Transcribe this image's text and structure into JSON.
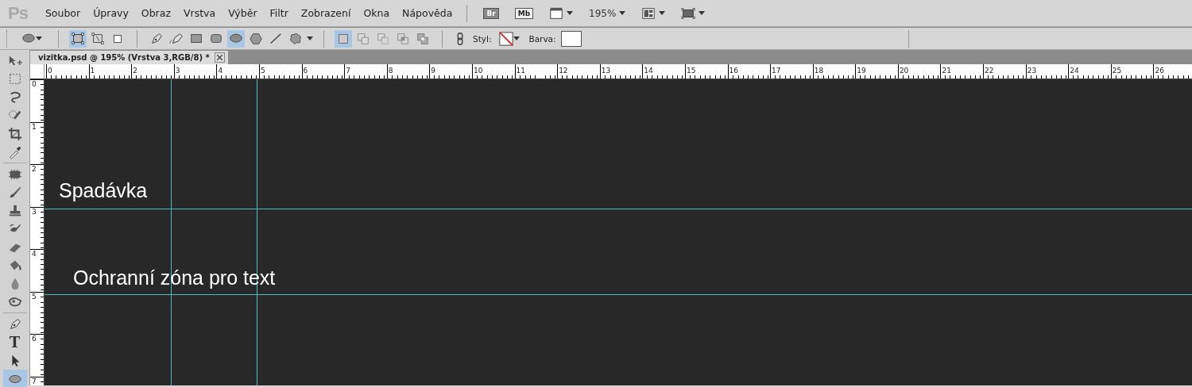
{
  "app_bar": {
    "logo": "Ps",
    "menu": [
      "Soubor",
      "Úpravy",
      "Obraz",
      "Vrstva",
      "Výběr",
      "Filtr",
      "Zobrazení",
      "Okna",
      "Nápověda"
    ],
    "buttons": [
      {
        "kind": "badge",
        "label": "Br"
      },
      {
        "kind": "badge",
        "label": "Mb"
      },
      {
        "kind": "frames"
      },
      {
        "kind": "zoom",
        "label": "195%"
      },
      {
        "kind": "arrange"
      },
      {
        "kind": "screen"
      }
    ]
  },
  "options_bar": {
    "preset": {
      "kind": "ellipse"
    },
    "modes": [
      {
        "kind": "shape-layer",
        "selected": true
      },
      {
        "kind": "paths",
        "selected": false
      },
      {
        "kind": "fill-pixels",
        "selected": false
      }
    ],
    "shapes": [
      {
        "kind": "pen",
        "selected": false
      },
      {
        "kind": "freeform-pen",
        "selected": false
      },
      {
        "kind": "rect",
        "selected": false
      },
      {
        "kind": "rounded-rect",
        "selected": false
      },
      {
        "kind": "ellipse",
        "selected": true
      },
      {
        "kind": "polygon",
        "selected": false
      },
      {
        "kind": "line",
        "selected": false
      },
      {
        "kind": "custom-shape",
        "selected": false
      }
    ],
    "combine": [
      {
        "kind": "new",
        "selected": true
      },
      {
        "kind": "add",
        "selected": false
      },
      {
        "kind": "subtract",
        "selected": false
      },
      {
        "kind": "intersect",
        "selected": false
      },
      {
        "kind": "exclude",
        "selected": false
      }
    ],
    "style_label": "Styl:",
    "color_label": "Barva:"
  },
  "toolbox": [
    [
      {
        "kind": "move",
        "selected": false
      },
      {
        "kind": "marquee",
        "selected": false
      },
      {
        "kind": "lasso",
        "selected": false
      },
      {
        "kind": "quick-select",
        "selected": false
      },
      {
        "kind": "crop",
        "selected": false
      },
      {
        "kind": "eyedropper",
        "selected": false
      }
    ],
    [
      {
        "kind": "healing",
        "selected": false
      },
      {
        "kind": "brush",
        "selected": false
      },
      {
        "kind": "stamp",
        "selected": false
      },
      {
        "kind": "history-brush",
        "selected": false
      },
      {
        "kind": "eraser",
        "selected": false
      },
      {
        "kind": "bucket",
        "selected": false
      },
      {
        "kind": "blur",
        "selected": false
      },
      {
        "kind": "dodge",
        "selected": false
      }
    ],
    [
      {
        "kind": "pen",
        "selected": false
      },
      {
        "kind": "type",
        "label": "T",
        "selected": false
      },
      {
        "kind": "path-select",
        "selected": false
      },
      {
        "kind": "shape",
        "selected": true
      }
    ]
  ],
  "document_tab": {
    "title": "vizitka.psd @ 195% (Vrstva 3,RGB/8) *"
  },
  "rulers": {
    "horizontal": [
      "0",
      "1",
      "2",
      "3",
      "4",
      "5",
      "6",
      "7",
      "8",
      "9",
      "10",
      "11",
      "12",
      "13",
      "14",
      "15",
      "16",
      "17",
      "18",
      "19",
      "20",
      "21",
      "22",
      "23",
      "24",
      "25",
      "26"
    ],
    "vertical": [
      "0",
      "1",
      "2",
      "3",
      "4",
      "5",
      "6",
      "7"
    ]
  },
  "canvas": {
    "labels": [
      {
        "text": "Spadávka"
      },
      {
        "text": "Ochranní zóna pro text"
      }
    ]
  }
}
